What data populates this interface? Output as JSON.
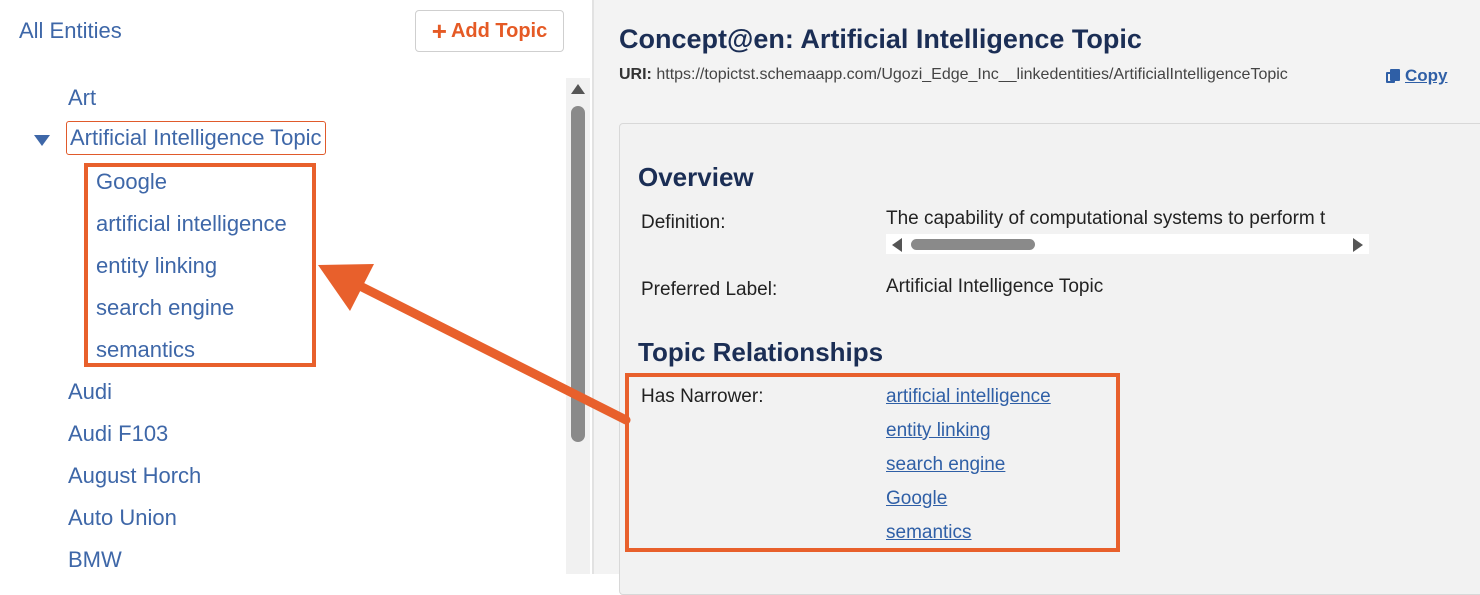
{
  "left": {
    "header": "All Entities",
    "add_topic_label": "Add Topic",
    "tree": [
      {
        "label": "Art"
      },
      {
        "label": "Artificial Intelligence Topic"
      },
      {
        "label": "Google"
      },
      {
        "label": "artificial intelligence"
      },
      {
        "label": "entity linking"
      },
      {
        "label": "search engine"
      },
      {
        "label": "semantics"
      },
      {
        "label": "Audi"
      },
      {
        "label": "Audi F103"
      },
      {
        "label": "August Horch"
      },
      {
        "label": "Auto Union"
      },
      {
        "label": "BMW"
      }
    ]
  },
  "right": {
    "title": "Concept@en: Artificial Intelligence Topic",
    "uri_label": "URI:",
    "uri_value": "https://topictst.schemaapp.com/Ugozi_Edge_Inc__linkedentities/ArtificialIntelligenceTopic",
    "copy_label": "Copy",
    "overview_heading": "Overview",
    "definition_label": "Definition:",
    "definition_value": "The capability of computational systems to perform t",
    "preferred_label_label": "Preferred Label:",
    "preferred_label_value": "Artificial Intelligence Topic",
    "relationships_heading": "Topic Relationships",
    "has_narrower_label": "Has Narrower:",
    "has_narrower_links": [
      "artificial intelligence",
      "entity linking",
      "search engine",
      "Google",
      "semantics"
    ]
  },
  "icons": {
    "add": "plus-icon",
    "expand": "caret-down-icon",
    "copy": "copy-icon"
  },
  "colors": {
    "accent": "#e8602c",
    "link": "#3e67a8",
    "heading": "#1b2e55"
  }
}
